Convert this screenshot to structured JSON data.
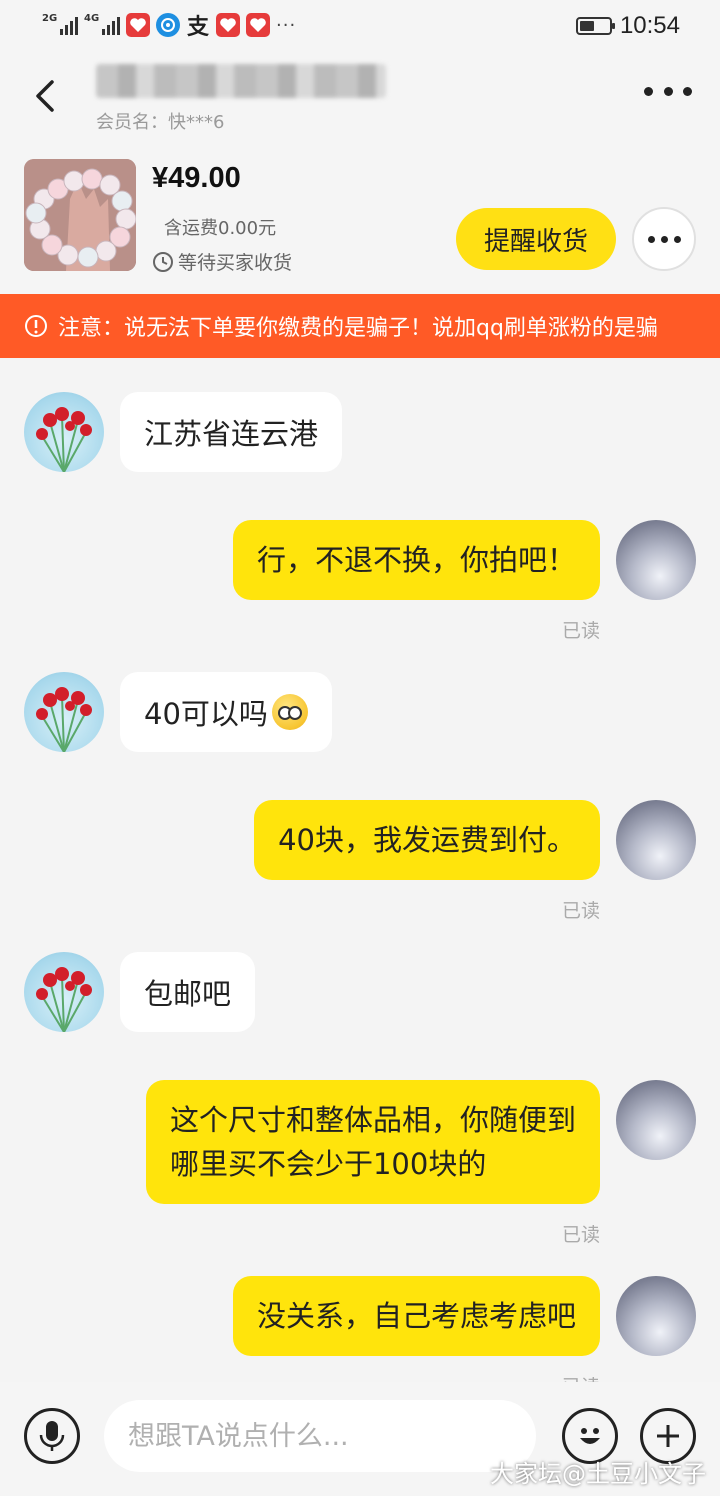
{
  "status_bar": {
    "sim1_label": "2G",
    "sim2_label": "4G",
    "more_dots": "···",
    "time": "10:54",
    "battery_level": 0.5,
    "app_icons": [
      "pinduoduo-icon",
      "qq-browser-icon",
      "alipay-icon",
      "pinduoduo-icon",
      "pinduoduo-icon"
    ],
    "alipay_char": "支"
  },
  "header": {
    "member_name": "会员名：快***6"
  },
  "product": {
    "price": "¥49.00",
    "shipping": "含运费0.00元",
    "status": "等待买家收货",
    "remind_label": "提醒收货"
  },
  "notice": {
    "text": "注意：说无法下单要你缴费的是骗子！说加qq刷单涨粉的是骗"
  },
  "messages": [
    {
      "side": "in",
      "text": "江苏省连云港"
    },
    {
      "side": "out",
      "text": "行，不退不换，你拍吧！",
      "read": "已读"
    },
    {
      "side": "in",
      "text": "40可以吗",
      "emoji": "rolling-eyes-emoji"
    },
    {
      "side": "out",
      "text": "40块，我发运费到付。",
      "read": "已读"
    },
    {
      "side": "in",
      "text": "包邮吧"
    },
    {
      "side": "out",
      "text_line1": "这个尺寸和整体品相，你随便到",
      "text_line2": "哪里买不会少于100块的",
      "read": "已读"
    },
    {
      "side": "out",
      "text": "没关系，自己考虑考虑吧",
      "read": "已读"
    }
  ],
  "input": {
    "placeholder": "想跟TA说点什么..."
  },
  "watermark": "大家坛@土豆小文子",
  "colors": {
    "accent_yellow": "#ffe014",
    "notice_orange": "#ff5a26",
    "background": "#f4f4f4"
  }
}
